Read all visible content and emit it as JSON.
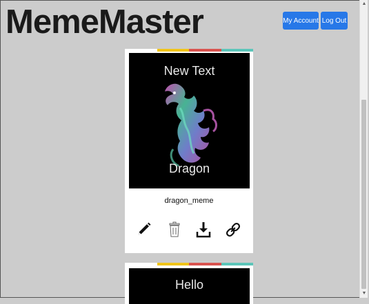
{
  "app": {
    "title": "MemeMaster"
  },
  "header": {
    "account_label": "My Account",
    "logout_label": "Log Out"
  },
  "memes": [
    {
      "top_text": "New Text",
      "bottom_text": "Dragon",
      "name": "dragon_meme"
    },
    {
      "top_text": "Hello"
    }
  ],
  "actions": [
    "pencil-icon",
    "trash-icon",
    "download-icon",
    "link-icon"
  ],
  "colors": {
    "accent": "#2778e8",
    "background": "#cccccc",
    "strip": [
      "#f0c419",
      "#d9534f",
      "#5cc5b9"
    ]
  }
}
